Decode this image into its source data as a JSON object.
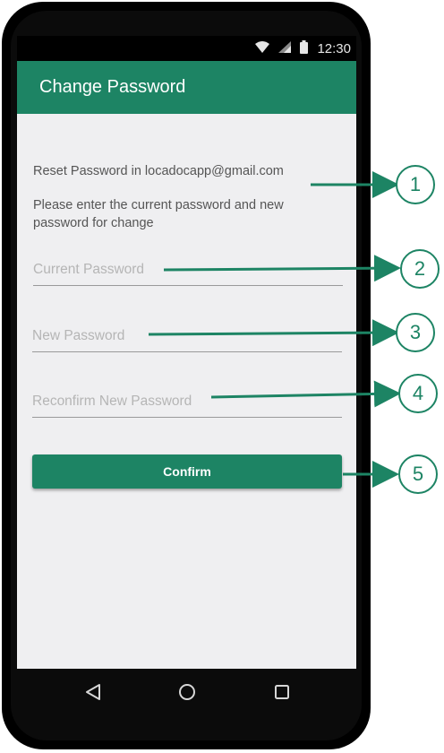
{
  "status_bar": {
    "time": "12:30",
    "icons": [
      "wifi-icon",
      "signal-icon",
      "battery-icon"
    ]
  },
  "app_bar": {
    "title": "Change Password"
  },
  "content": {
    "reset_text": "Reset Password in locadocapp@gmail.com",
    "instructions": "Please enter the current password and new password for change",
    "current_password_placeholder": "Current Password",
    "new_password_placeholder": "New Password",
    "reconfirm_password_placeholder": "Reconfirm New Password",
    "confirm_label": "Confirm"
  },
  "nav_bar": {
    "icons": [
      "back-icon",
      "home-icon",
      "recents-icon"
    ]
  },
  "callouts": [
    "1",
    "2",
    "3",
    "4",
    "5"
  ],
  "colors": {
    "accent": "#1d8464",
    "screen_bg": "#efeff1",
    "phone_body": "#000000"
  }
}
